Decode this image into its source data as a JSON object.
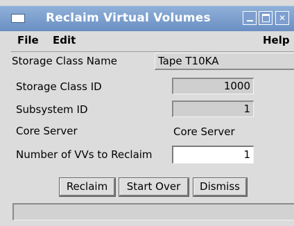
{
  "window": {
    "title": "Reclaim Virtual Volumes",
    "controls": {
      "minimize": "_",
      "maximize": "□",
      "close": "✕"
    }
  },
  "menubar": {
    "file": "File",
    "edit": "Edit",
    "help": "Help"
  },
  "form": {
    "storage_class_name": {
      "label": "Storage Class Name",
      "value": "Tape T10KA"
    },
    "storage_class_id": {
      "label": "Storage Class ID",
      "value": "1000"
    },
    "subsystem_id": {
      "label": "Subsystem ID",
      "value": "1"
    },
    "core_server": {
      "label": "Core Server",
      "value": "Core Server"
    },
    "num_vvs": {
      "label": "Number of VVs to Reclaim",
      "value": "1"
    }
  },
  "buttons": {
    "reclaim": "Reclaim",
    "start_over": "Start Over",
    "dismiss": "Dismiss"
  },
  "status": {
    "text": ""
  },
  "colors": {
    "titlebar": "#7a9bcc",
    "window_bg": "#dcdcdc"
  }
}
